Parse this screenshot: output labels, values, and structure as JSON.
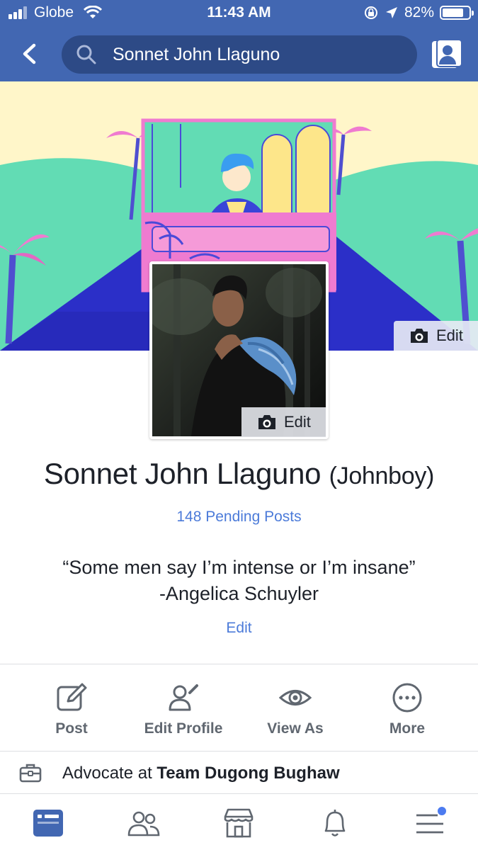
{
  "status_bar": {
    "carrier": "Globe",
    "time": "11:43 AM",
    "battery": "82%",
    "battery_level": 0.82
  },
  "header": {
    "search_value": "Sonnet John Llaguno"
  },
  "cover": {
    "edit_label": "Edit"
  },
  "profile_picture": {
    "edit_label": "Edit"
  },
  "profile": {
    "name": "Sonnet John Llaguno",
    "nickname": "(Johnboy)",
    "pending_posts": "148 Pending Posts",
    "bio_line1": "“Some men say I’m intense or I’m insane”",
    "bio_line2": "-Angelica Schuyler",
    "bio_edit": "Edit"
  },
  "actions": [
    {
      "label": "Post",
      "icon": "compose-icon"
    },
    {
      "label": "Edit Profile",
      "icon": "edit-user-icon"
    },
    {
      "label": "View As",
      "icon": "eye-icon"
    },
    {
      "label": "More",
      "icon": "more-icon"
    }
  ],
  "work": {
    "prefix": "Advocate at ",
    "org": "Team Dugong Bughaw"
  },
  "tabs": [
    {
      "name": "news-feed",
      "icon": "news-feed-icon",
      "active": true
    },
    {
      "name": "friends",
      "icon": "friends-icon"
    },
    {
      "name": "marketplace",
      "icon": "marketplace-icon"
    },
    {
      "name": "notifications",
      "icon": "bell-icon"
    },
    {
      "name": "menu",
      "icon": "menu-icon",
      "badge": true
    }
  ],
  "colors": {
    "brand_blue": "#4267b2",
    "search_bg": "#2d4a86",
    "link_blue": "#4c7bd9",
    "muted_text": "#606770"
  }
}
